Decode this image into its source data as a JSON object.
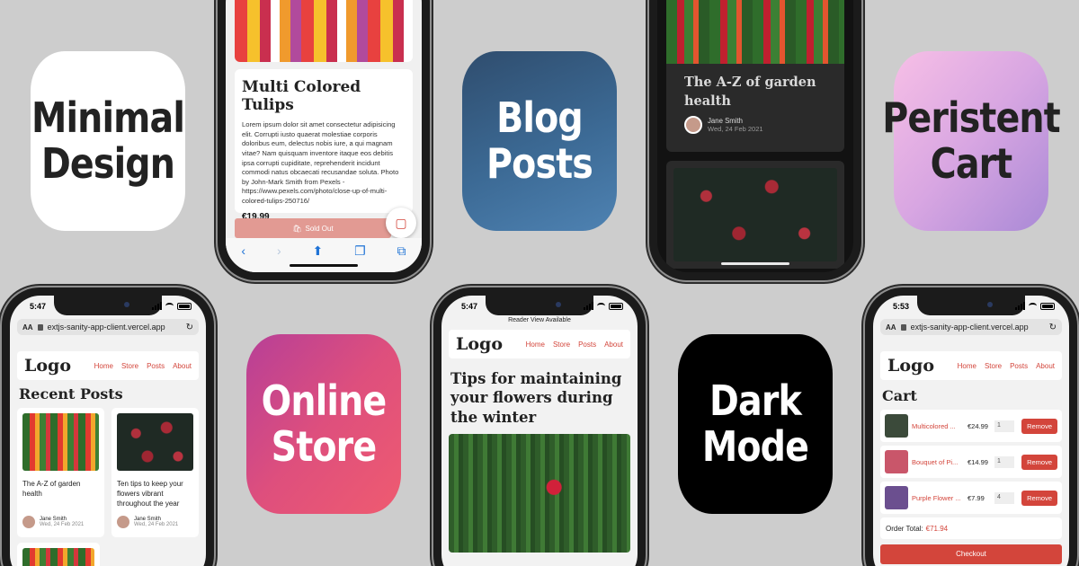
{
  "tiles": {
    "minimal": "Minimal\nDesign",
    "blog": "Blog\nPosts",
    "cart": "Peristent\nCart",
    "store": "Online\nStore",
    "dark": "Dark\nMode"
  },
  "status": {
    "time_1": "5:47",
    "time_2": "5:47",
    "time_3": "5:53"
  },
  "browser": {
    "aa": "AA",
    "url": "extjs-sanity-app-client.vercel.app",
    "reader_view": "Reader View Available"
  },
  "nav": {
    "logo": "Logo",
    "links": [
      "Home",
      "Store",
      "Posts",
      "About"
    ]
  },
  "product": {
    "title": "Multi Colored Tulips",
    "description": "Lorem ipsum dolor sit amet consectetur adipisicing elit. Corrupti iusto quaerat molestiae corporis doloribus eum, delectus nobis iure, a qui magnam vitae? Nam quisquam inventore itaque eos debitis ipsa corrupti cupiditate, reprehenderit incidunt commodi natus obcaecati recusandae soluta. Photo by John-Mark Smith from Pexels - https://www.pexels.com/photo/close-up-of-multi-colored-tulips-250716/",
    "price": "€19.99",
    "sold_out": "Sold Out"
  },
  "dark_post": {
    "title": "The A-Z of garden health",
    "author": "Jane Smith",
    "date": "Wed, 24 Feb 2021"
  },
  "recent": {
    "heading": "Recent Posts",
    "posts": [
      {
        "title": "The A-Z of garden health",
        "author": "Jane Smith",
        "date": "Wed, 24 Feb 2021"
      },
      {
        "title": "Ten tips to keep your flowers vibrant throughout the year",
        "author": "Jane Smith",
        "date": "Wed, 24 Feb 2021"
      }
    ]
  },
  "article": {
    "title": "Tips for maintaining your flowers during the winter"
  },
  "cart": {
    "heading": "Cart",
    "items": [
      {
        "name": "Multicolored ...",
        "price": "€24.99",
        "qty": "1",
        "remove": "Remove",
        "color": "#3b4a3a"
      },
      {
        "name": "Bouquet of Pi...",
        "price": "€14.99",
        "qty": "1",
        "remove": "Remove",
        "color": "#c9566a"
      },
      {
        "name": "Purple Flower ...",
        "price": "€7.99",
        "qty": "4",
        "remove": "Remove",
        "color": "#6b4f8f"
      }
    ],
    "total_label": "Order Total:",
    "total_value": "€71.94",
    "checkout": "Checkout"
  },
  "colors": {
    "accent": "#d3453b",
    "background": "#cdcdcd",
    "dark_card": "#2a2a2a"
  }
}
